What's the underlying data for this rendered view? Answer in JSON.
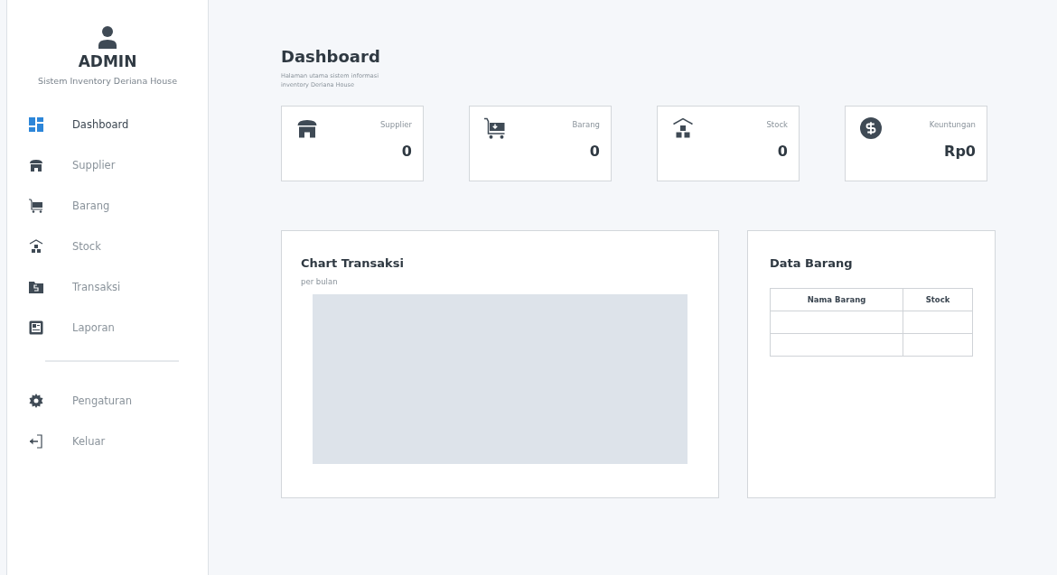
{
  "sidebar": {
    "user": {
      "name": "ADMIN",
      "subtitle": "Sistem Inventory Deriana House"
    },
    "items": [
      {
        "label": "Dashboard",
        "kind": "dashboard",
        "selected": true
      },
      {
        "label": "Supplier",
        "kind": "store",
        "selected": false
      },
      {
        "label": "Barang",
        "kind": "cart",
        "selected": false
      },
      {
        "label": "Stock",
        "kind": "warehouse",
        "selected": false
      },
      {
        "label": "Transaksi",
        "kind": "money",
        "selected": false
      },
      {
        "label": "Laporan",
        "kind": "report",
        "selected": false
      }
    ],
    "footer_items": [
      {
        "label": "Pengaturan",
        "kind": "gear",
        "selected": false
      },
      {
        "label": "Keluar",
        "kind": "logout",
        "selected": false
      }
    ]
  },
  "header": {
    "title": "Dashboard",
    "subtitle": "Halaman utama sistem informasi inventory Deriana House"
  },
  "stats": [
    {
      "label": "Supplier",
      "value": "0",
      "kind": "store"
    },
    {
      "label": "Barang",
      "value": "0",
      "kind": "cart"
    },
    {
      "label": "Stock",
      "value": "0",
      "kind": "warehouse"
    },
    {
      "label": "Keuntungan",
      "value": "Rp0",
      "kind": "coin"
    }
  ],
  "chart_panel": {
    "title": "Chart Transaksi",
    "subtitle": "per bulan"
  },
  "table_panel": {
    "title": "Data Barang",
    "columns": [
      "Nama Barang",
      "Stock"
    ]
  }
}
